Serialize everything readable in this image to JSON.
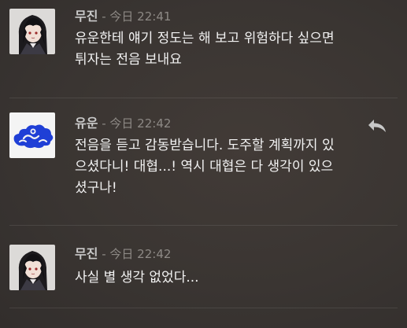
{
  "messages": [
    {
      "author": "무진",
      "separator": " - ",
      "timestamp": "今日 22:41",
      "text": "유운한테 얘기 정도는 해 보고 위험하다 싶으면\n튀자는 전음 보내요",
      "avatar_icon": "avatar-mujin"
    },
    {
      "author": "유운",
      "separator": " - ",
      "timestamp": "今日 22:42",
      "text": "전음을 듣고 감동받습니다. 도주할 계획까지 있\n으셨다니! 대협...! 역시 대협은 다 생각이 있으\n셨구나!",
      "avatar_icon": "avatar-cloud",
      "reply_icon": "reply-arrow-icon"
    },
    {
      "author": "무진",
      "separator": " - ",
      "timestamp": "今日 22:42",
      "text": "사실 별 생각 없었다...",
      "avatar_icon": "avatar-mujin"
    }
  ],
  "colors": {
    "background": "#3a3532",
    "author": "#c9c9c9",
    "timestamp": "#8d8985",
    "body_text": "#f2f2f2",
    "cloud_blue": "#1f3fd6"
  }
}
